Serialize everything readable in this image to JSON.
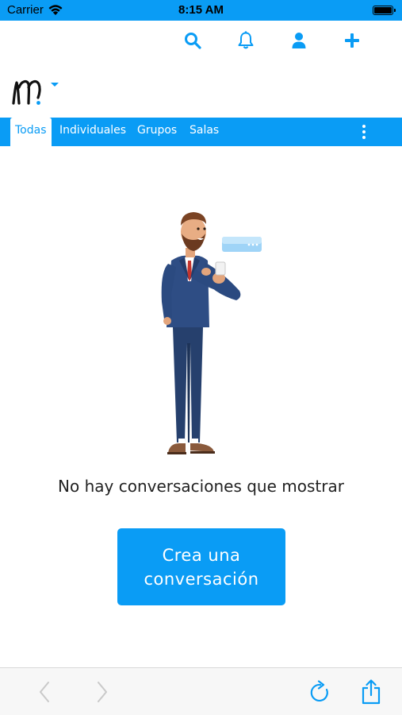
{
  "status_bar": {
    "carrier": "Carrier",
    "time": "8:15 AM"
  },
  "header": {
    "actions": [
      {
        "icon": "search-icon"
      },
      {
        "icon": "bell-icon"
      },
      {
        "icon": "user-icon"
      },
      {
        "icon": "plus-icon"
      }
    ]
  },
  "tabs": {
    "items": [
      {
        "label": "Todas",
        "active": true
      },
      {
        "label": "Individuales",
        "active": false
      },
      {
        "label": "Grupos",
        "active": false
      },
      {
        "label": "Salas",
        "active": false
      }
    ]
  },
  "empty_state": {
    "message": "No hay conversaciones que mostrar",
    "cta_label": "Crea una conversación"
  },
  "toolbar": {
    "buttons": [
      {
        "icon": "back-chevron-icon"
      },
      {
        "icon": "forward-chevron-icon"
      },
      {
        "icon": "reload-icon"
      },
      {
        "icon": "share-icon"
      }
    ]
  },
  "colors": {
    "accent": "#0a9cf5",
    "text": "#222222",
    "toolbar_bg": "#f7f7f7"
  }
}
